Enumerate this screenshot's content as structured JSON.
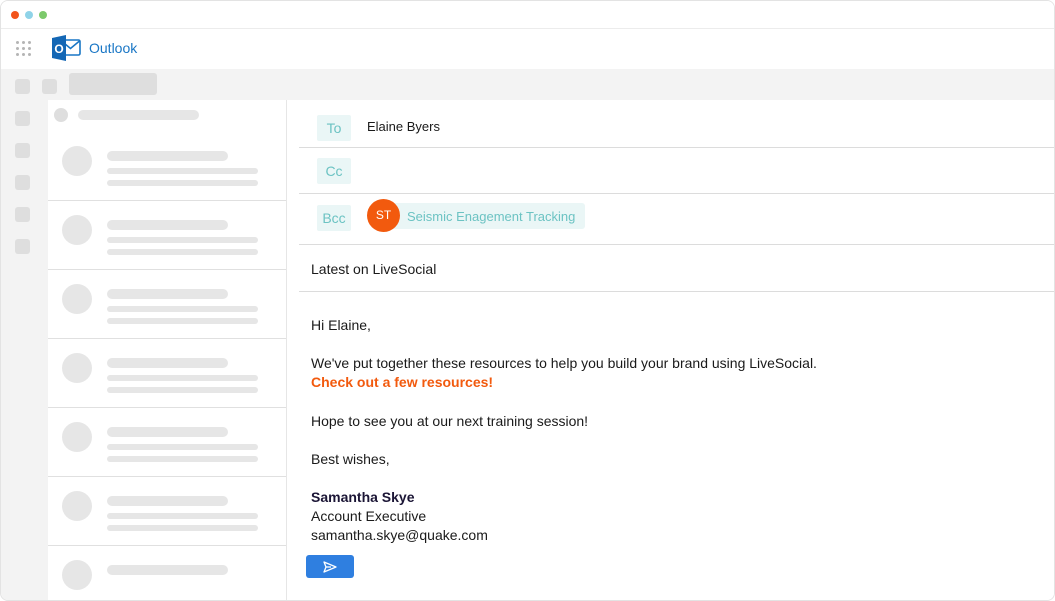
{
  "app": {
    "title": "Outlook",
    "logo_letter": "O"
  },
  "compose": {
    "to_label": "To",
    "to_value": "Elaine Byers",
    "cc_label": "Cc",
    "bcc_label": "Bcc",
    "bcc_chip": {
      "initials": "ST",
      "text": "Seismic Enagement Tracking"
    },
    "subject": "Latest on LiveSocial",
    "body": {
      "greeting": "Hi Elaine,",
      "intro": "We've put together these resources to help you build your brand using LiveSocial.",
      "cta_link": "Check out a few resources!",
      "closing_line": "Hope to see you at our next training session!",
      "signoff": "Best wishes,",
      "sender_name": "Samantha Skye",
      "sender_title": "Account Executive",
      "sender_email": "samantha.skye@quake.com"
    },
    "send_icon": "send-icon"
  },
  "colors": {
    "accent_orange": "#f25a0e",
    "outlook_blue": "#1976c5",
    "send_blue": "#2f7fe0",
    "field_label_teal": "#6cc3c3",
    "field_label_bg": "#eaf6f6"
  }
}
